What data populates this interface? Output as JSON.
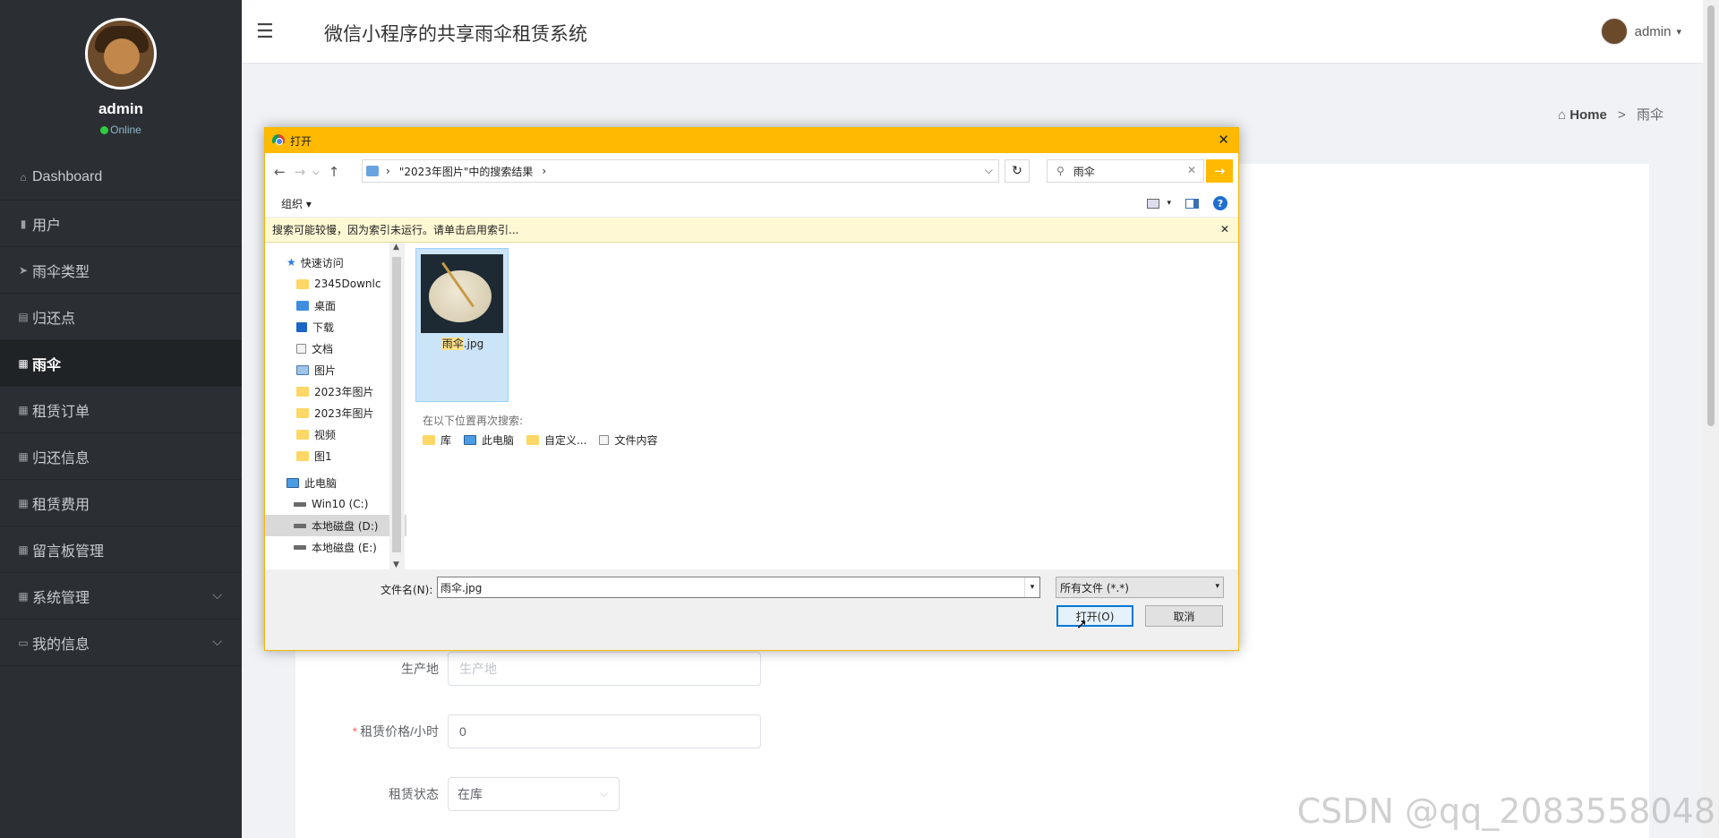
{
  "sidebar": {
    "user": {
      "name": "admin",
      "status": "Online"
    },
    "items": [
      {
        "label": "Dashboard",
        "icon": "home-outline-icon"
      },
      {
        "label": "用户",
        "icon": "book-icon"
      },
      {
        "label": "雨伞类型",
        "icon": "send-icon"
      },
      {
        "label": "归还点",
        "icon": "clipboard-icon"
      },
      {
        "label": "雨伞",
        "icon": "grid-icon"
      },
      {
        "label": "租赁订单",
        "icon": "grid-icon"
      },
      {
        "label": "归还信息",
        "icon": "grid-icon"
      },
      {
        "label": "租赁费用",
        "icon": "grid-icon"
      },
      {
        "label": "留言板管理",
        "icon": "table-icon"
      },
      {
        "label": "系统管理",
        "icon": "grid-icon"
      },
      {
        "label": "我的信息",
        "icon": "card-icon"
      }
    ],
    "active": "雨伞"
  },
  "header": {
    "title": "微信小程序的共享雨伞租赁系统",
    "user": "admin"
  },
  "breadcrumb": {
    "home": "Home",
    "separator": ">",
    "current": "雨伞"
  },
  "form": {
    "origin": {
      "label": "生产地",
      "placeholder": "生产地"
    },
    "price": {
      "label": "租赁价格/小时",
      "value": "0",
      "required_mark": "*"
    },
    "status": {
      "label": "租赁状态",
      "value": "在库"
    }
  },
  "dialog": {
    "title": "打开",
    "path": "\"2023年图片\"中的搜索结果",
    "search": "雨伞",
    "organize": "组织",
    "info": "搜索可能较慢，因为索引未运行。请单击启用索引...",
    "tree": [
      {
        "label": "快速访问",
        "icon": "star-icon"
      },
      {
        "label": "2345Downlc",
        "icon": "folder-icon",
        "pinned": true
      },
      {
        "label": "桌面",
        "icon": "desktop-icon",
        "pinned": true
      },
      {
        "label": "下载",
        "icon": "download-icon",
        "pinned": true
      },
      {
        "label": "文档",
        "icon": "document-icon",
        "pinned": true
      },
      {
        "label": "图片",
        "icon": "pictures-icon",
        "pinned": true
      },
      {
        "label": "2023年图片",
        "icon": "folder-icon"
      },
      {
        "label": "2023年图片",
        "icon": "folder-icon"
      },
      {
        "label": "视频",
        "icon": "folder-icon"
      },
      {
        "label": "图1",
        "icon": "folder-icon"
      },
      {
        "label": "此电脑",
        "icon": "computer-icon"
      },
      {
        "label": "Win10 (C:)",
        "icon": "drive-icon"
      },
      {
        "label": "本地磁盘 (D:)",
        "icon": "drive-icon",
        "selected": true
      },
      {
        "label": "本地磁盘 (E:)",
        "icon": "drive-icon"
      }
    ],
    "file": {
      "highlight": "雨伞",
      "rest": ".jpg"
    },
    "search_again": "在以下位置再次搜索:",
    "search_locations": [
      "库",
      "此电脑",
      "自定义...",
      "文件内容"
    ],
    "filename_label": "文件名(N):",
    "filename": "雨伞.jpg",
    "filetype": "所有文件 (*.*)",
    "open_btn": "打开(O)",
    "cancel_btn": "取消"
  },
  "watermark": "CSDN @qq_2083558048",
  "colors": {
    "sidebar": "#2b2f33",
    "dialog_accent": "#ffba00",
    "selection": "#cce4f7"
  }
}
